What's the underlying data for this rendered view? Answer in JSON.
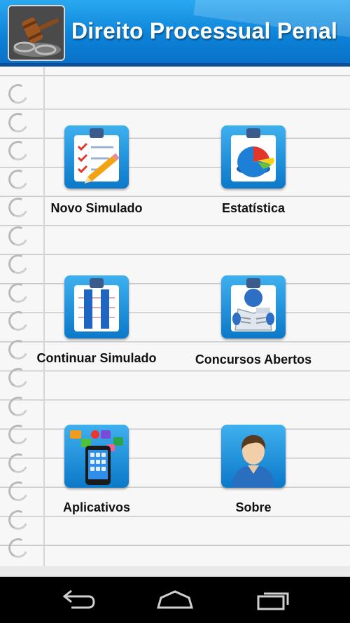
{
  "header": {
    "title": "Direito Processual Penal",
    "logo_icon": "gavel-icon"
  },
  "menu": [
    {
      "label": "Novo Simulado",
      "icon": "checklist-icon"
    },
    {
      "label": "Estatística",
      "icon": "pie-chart-icon"
    },
    {
      "label": "Continuar Simulado",
      "icon": "pause-icon"
    },
    {
      "label": "Concursos Abertos",
      "icon": "newspaper-icon"
    },
    {
      "label": "Aplicativos",
      "icon": "smartphone-apps-icon"
    },
    {
      "label": "Sobre",
      "icon": "user-icon"
    }
  ],
  "navbar": {
    "back_icon": "back-icon",
    "home_icon": "home-icon",
    "recents_icon": "recents-icon"
  },
  "colors": {
    "header_blue": "#0c82d8",
    "icon_blue": "#1a8fe0",
    "nav_background": "#000000"
  }
}
